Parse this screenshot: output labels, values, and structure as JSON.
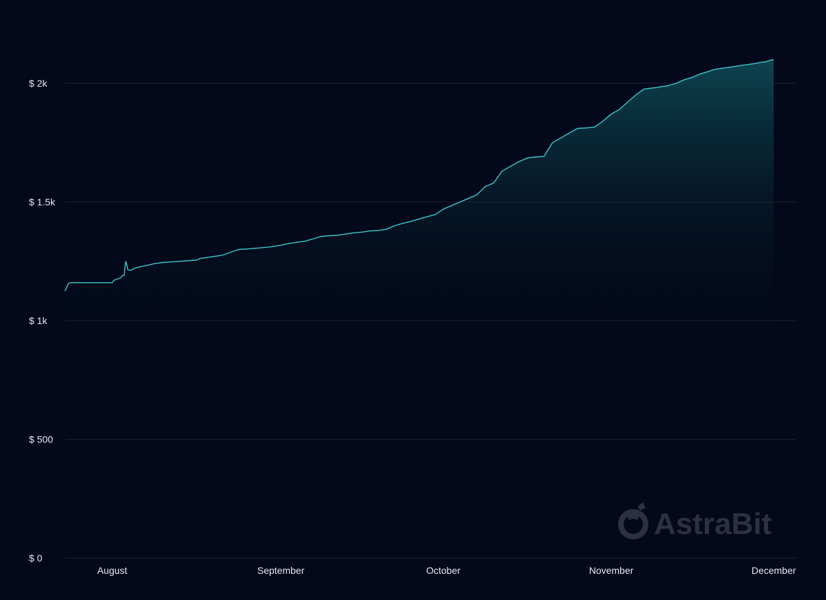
{
  "colors": {
    "background": "#03091a",
    "grid": "#1c2234",
    "line": "#3fc7cf",
    "area_top": "#0e4a55",
    "area_bottom": "#03091a",
    "tick_text": "#e6e9f0",
    "watermark": "#2b3142"
  },
  "watermark": {
    "text": "AstraBit",
    "icon": "astronaut-helmet-icon"
  },
  "chart_data": {
    "type": "area",
    "title": "",
    "xlabel": "",
    "ylabel": "",
    "y_tick_values": [
      0,
      500,
      1000,
      1500,
      2000
    ],
    "y_tick_labels": [
      "$ 0",
      "$ 500",
      "$ 1k",
      "$ 1.5k",
      "$ 2k"
    ],
    "ylim": [
      0,
      2000
    ],
    "x_tick_labels": [
      "August",
      "September",
      "October",
      "November",
      "December"
    ],
    "x_tick_positions": [
      0,
      1,
      2,
      3,
      4
    ],
    "xlim": [
      -0.28,
      4.0
    ],
    "grid": true,
    "legend": "none",
    "series": [
      {
        "x": [
          -0.28,
          -0.27,
          -0.26,
          -0.25,
          0.0,
          0.01,
          0.05,
          0.06,
          0.07,
          0.08,
          0.085,
          0.09,
          0.092,
          0.1,
          0.105,
          0.12,
          0.13,
          0.15,
          0.2,
          0.25,
          0.3,
          0.4,
          0.5,
          0.52,
          0.55,
          0.6,
          0.65,
          0.75,
          0.8,
          0.85,
          0.9,
          0.95,
          1.0,
          1.05,
          1.1,
          1.15,
          1.2,
          1.25,
          1.3,
          1.35,
          1.4,
          1.45,
          1.5,
          1.55,
          1.6,
          1.65,
          1.7,
          1.75,
          1.8,
          1.85,
          1.9,
          1.95,
          2.0,
          2.05,
          2.1,
          2.15,
          2.2,
          2.25,
          2.3,
          2.35,
          2.4,
          2.45,
          2.5,
          2.55,
          2.6,
          2.65,
          2.7,
          2.75,
          2.8,
          2.85,
          2.9,
          2.95,
          3.0,
          3.05,
          3.1,
          3.15,
          3.2,
          3.25,
          3.28,
          3.3,
          3.35,
          3.4,
          3.45,
          3.5,
          3.55,
          3.6,
          3.62,
          3.65,
          3.7,
          3.75,
          3.8,
          3.85,
          3.9,
          3.92,
          3.95,
          3.97,
          3.99,
          4.0
        ],
        "y": [
          1125,
          1140,
          1155,
          1160,
          1160,
          1170,
          1180,
          1190,
          1190,
          1250,
          1240,
          1225,
          1215,
          1213,
          1212,
          1215,
          1220,
          1225,
          1232,
          1240,
          1245,
          1250,
          1255,
          1262,
          1265,
          1270,
          1275,
          1300,
          1302,
          1305,
          1308,
          1312,
          1318,
          1325,
          1330,
          1335,
          1345,
          1355,
          1358,
          1360,
          1365,
          1370,
          1373,
          1378,
          1380,
          1385,
          1400,
          1410,
          1418,
          1428,
          1438,
          1447,
          1470,
          1485,
          1500,
          1515,
          1530,
          1565,
          1580,
          1630,
          1650,
          1670,
          1685,
          1690,
          1692,
          1750,
          1770,
          1790,
          1810,
          1812,
          1815,
          1840,
          1870,
          1890,
          1920,
          1950,
          1975,
          1980,
          1982,
          1985,
          1990,
          2000,
          2015,
          2025,
          2040,
          2050,
          2055,
          2060,
          2065,
          2070,
          2075,
          2080,
          2085,
          2088,
          2090,
          2095,
          2098,
          2100
        ],
        "name": ""
      }
    ]
  }
}
